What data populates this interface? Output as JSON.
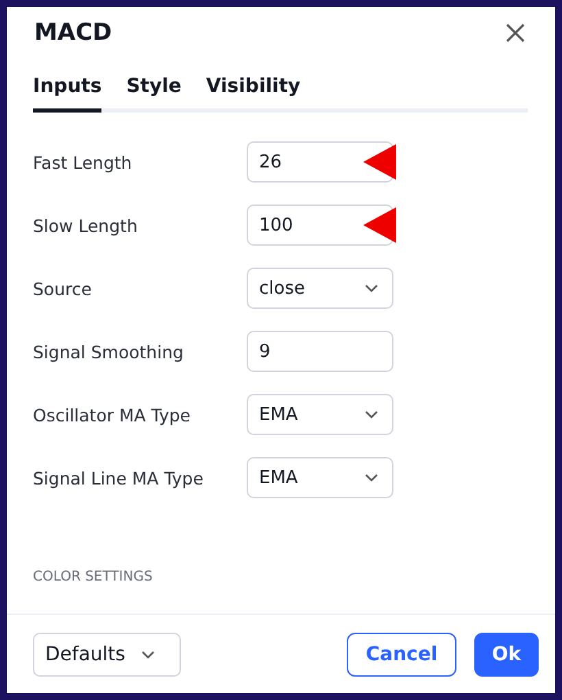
{
  "dialog": {
    "title": "MACD"
  },
  "tabs": [
    {
      "label": "Inputs",
      "selected": true
    },
    {
      "label": "Style",
      "selected": false
    },
    {
      "label": "Visibility",
      "selected": false
    }
  ],
  "fields": [
    {
      "label": "Fast Length",
      "kind": "input",
      "value": "26",
      "marked": true
    },
    {
      "label": "Slow Length",
      "kind": "input",
      "value": "100",
      "marked": true
    },
    {
      "label": "Source",
      "kind": "select",
      "value": "close",
      "marked": false
    },
    {
      "label": "Signal Smoothing",
      "kind": "input",
      "value": "9",
      "marked": false
    },
    {
      "label": "Oscillator MA Type",
      "kind": "select",
      "value": "EMA",
      "marked": false
    },
    {
      "label": "Signal Line MA Type",
      "kind": "select",
      "value": "EMA",
      "marked": false
    }
  ],
  "section_heading": "COLOR SETTINGS",
  "footer": {
    "defaults": "Defaults",
    "cancel": "Cancel",
    "ok": "Ok"
  }
}
